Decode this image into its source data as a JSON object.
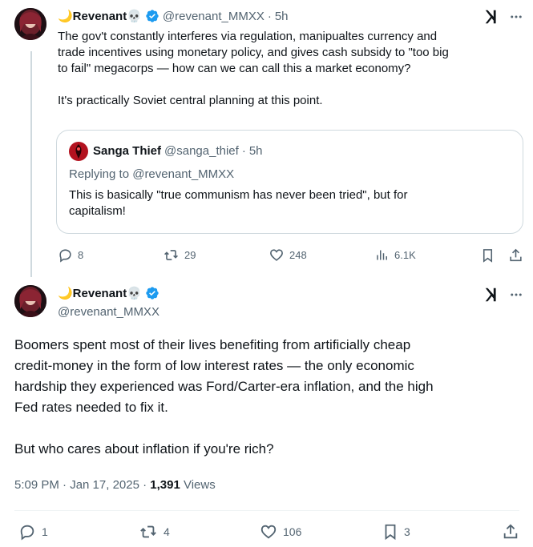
{
  "reply_tweet": {
    "display_name": "🌙Revenant💀",
    "handle": "@revenant_MMXX",
    "time": "5h",
    "text_line1": "The gov't constantly interferes via regulation, manipualtes currency and",
    "text_line2": "trade incentives using monetary policy, and gives cash subsidy to \"too big",
    "text_line3": "to fail\" megacorps — how can we can call this a market economy?",
    "text_line4": "It's practically Soviet central planning at this point.",
    "quote": {
      "display_name": "Sanga Thief",
      "handle": "@sanga_thief",
      "time": "5h",
      "replying_to": "Replying to @revenant_MMXX",
      "text_line1": "This is basically \"true communism has never been tried\", but for",
      "text_line2": "capitalism!"
    },
    "stats": {
      "replies": "8",
      "reposts": "29",
      "likes": "248",
      "views": "6.1K"
    }
  },
  "main_tweet": {
    "display_name": "🌙Revenant💀",
    "handle": "@revenant_MMXX",
    "text_line1": "Boomers spent most of their lives benefiting from artificially cheap",
    "text_line2": "credit-money in the form of low interest rates — the only economic",
    "text_line3": "hardship they experienced was Ford/Carter-era inflation, and the high",
    "text_line4": "Fed rates needed to fix it.",
    "text_line5": "But who cares about inflation if you're rich?",
    "timestamp": "5:09 PM · Jan 17, 2025 · ",
    "views_count": "1,391",
    "views_label": " Views",
    "stats": {
      "replies": "1",
      "reposts": "4",
      "likes": "106",
      "bookmarks": "3"
    }
  },
  "separator": " · ",
  "colors": {
    "verified": "#1d9bf0",
    "muted": "#536471",
    "border": "#cfd9de"
  },
  "icons": [
    "verified-icon",
    "grok-icon",
    "more-icon",
    "reply-icon",
    "repost-icon",
    "like-icon",
    "views-icon",
    "bookmark-icon",
    "share-icon"
  ]
}
